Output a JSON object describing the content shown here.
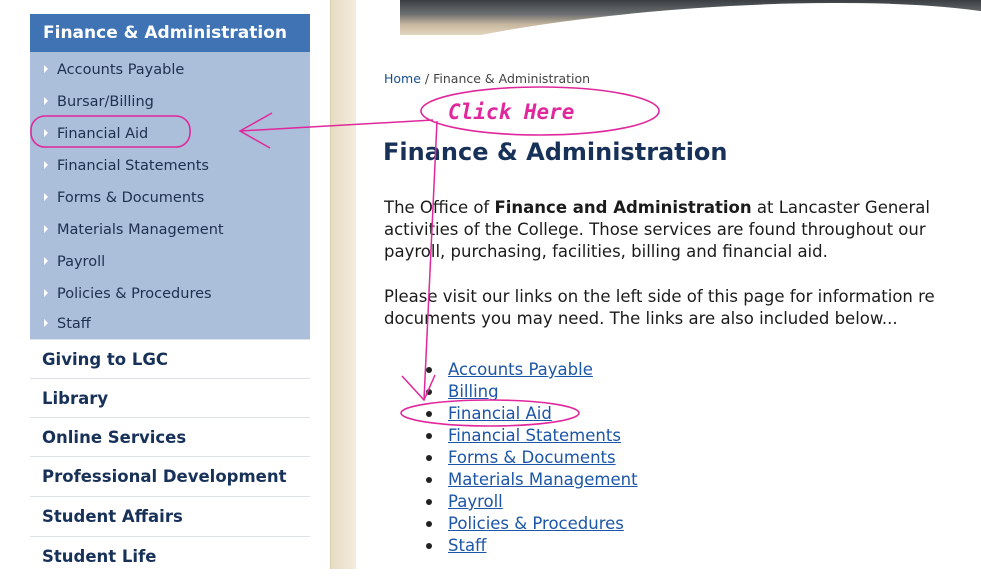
{
  "sidebar": {
    "section_title": "Finance & Administration",
    "sub_items": [
      {
        "label": "Accounts Payable"
      },
      {
        "label": "Bursar/Billing"
      },
      {
        "label": "Financial Aid"
      },
      {
        "label": "Financial Statements"
      },
      {
        "label": "Forms & Documents"
      },
      {
        "label": "Materials Management"
      },
      {
        "label": "Payroll"
      },
      {
        "label": "Policies & Procedures"
      },
      {
        "label": "Staff"
      }
    ],
    "main_items": [
      {
        "label": "Giving to LGC"
      },
      {
        "label": "Library"
      },
      {
        "label": "Online Services"
      },
      {
        "label": "Professional Development"
      },
      {
        "label": "Student Affairs"
      },
      {
        "label": "Student Life"
      }
    ]
  },
  "breadcrumb": {
    "home": "Home",
    "separator": "/",
    "current": "Finance & Administration"
  },
  "main": {
    "title": "Finance & Administration",
    "intro_line1_pre": "The Office of ",
    "intro_line1_bold": "Finance and Administration",
    "intro_line1_post": " at Lancaster General",
    "intro_line2": "activities of the College. Those services are found throughout our",
    "intro_line3": "payroll, purchasing, facilities, billing and financial aid.",
    "visit_line1": "Please visit our links on the left side of this page for information re",
    "visit_line2": "documents you may need.  The links are also included below...",
    "links": [
      {
        "label": "Accounts Payable"
      },
      {
        "label": "Billing"
      },
      {
        "label": "Financial Aid"
      },
      {
        "label": "Financial Statements"
      },
      {
        "label": "Forms & Documents"
      },
      {
        "label": "Materials Management"
      },
      {
        "label": "Payroll"
      },
      {
        "label": "Policies & Procedures"
      },
      {
        "label": "Staff"
      }
    ]
  },
  "annotation": {
    "label": "Click Here"
  },
  "colors": {
    "section_head_bg": "#3f73b4",
    "submenu_bg": "#abbfda",
    "nav_text": "#173159",
    "link": "#1c56a8",
    "annotation": "#e0279c"
  }
}
